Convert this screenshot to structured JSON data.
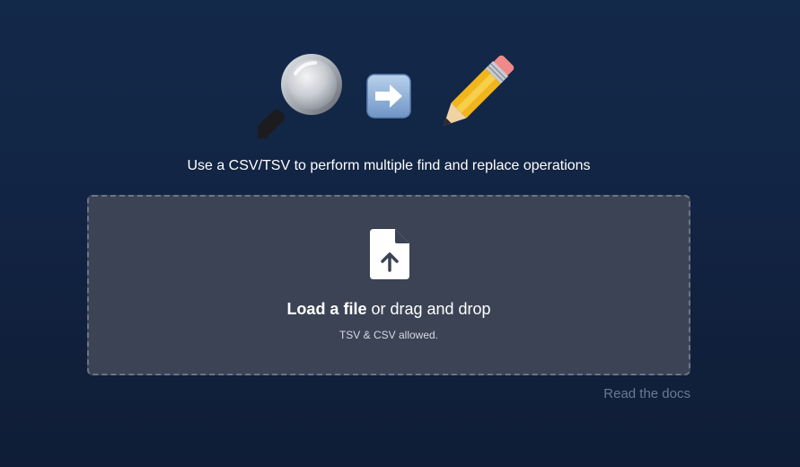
{
  "hero": {
    "icons": [
      "magnifying-glass-icon",
      "right-arrow-icon",
      "pencil-icon"
    ]
  },
  "subtitle": "Use a CSV/TSV to perform multiple find and replace operations",
  "dropzone": {
    "icon": "file-upload-icon",
    "load_link": "Load a file",
    "load_rest": " or drag and drop",
    "hint": "TSV & CSV allowed."
  },
  "docs_link": "Read the docs",
  "colors": {
    "background": "#13294a",
    "dropzone_bg": "#3b4354",
    "dropzone_border": "#6c7586",
    "docs_link": "#6b7a90",
    "arrow_tile": "#8fb3dd",
    "pencil_body": "#f2b51b"
  }
}
